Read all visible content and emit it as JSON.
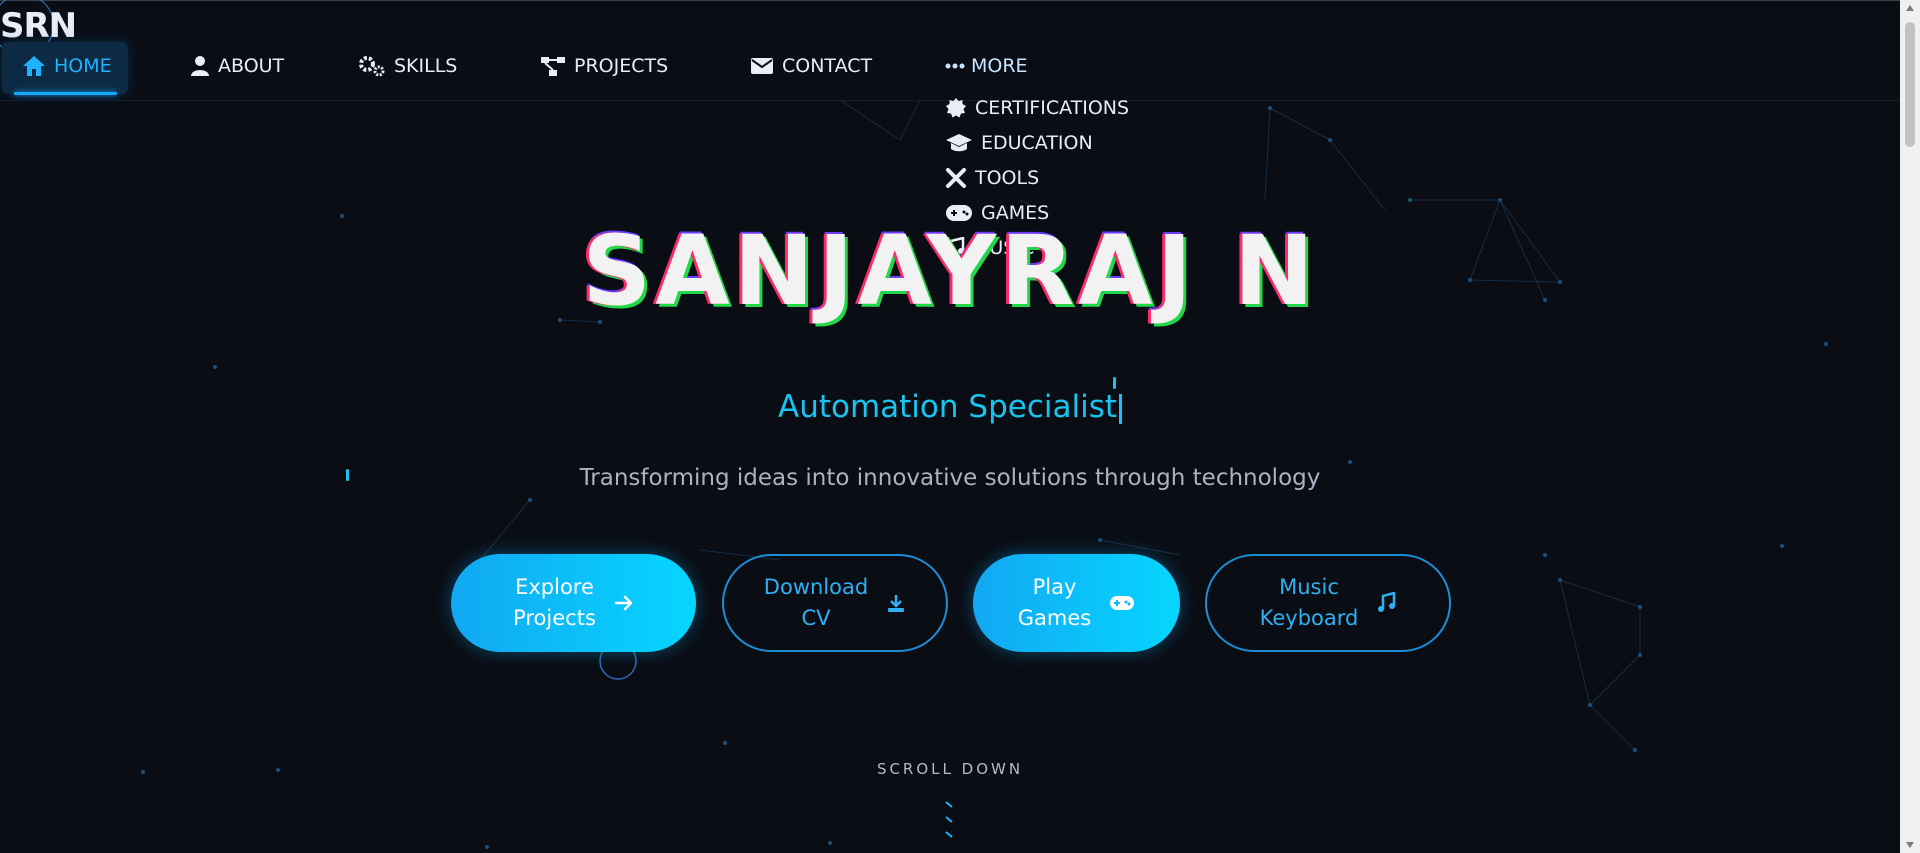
{
  "logo": {
    "text": "SRN"
  },
  "nav": {
    "items": [
      {
        "label": "HOME",
        "icon": "home-icon",
        "active": true
      },
      {
        "label": "ABOUT",
        "icon": "user-icon",
        "active": false
      },
      {
        "label": "SKILLS",
        "icon": "gears-icon",
        "active": false
      },
      {
        "label": "PROJECTS",
        "icon": "project-diagram-icon",
        "active": false
      },
      {
        "label": "CONTACT",
        "icon": "envelope-icon",
        "active": false
      }
    ],
    "more": {
      "label": "MORE",
      "icon": "ellipsis-icon",
      "items": [
        {
          "label": "CERTIFICATIONS",
          "icon": "certificate-icon"
        },
        {
          "label": "EDUCATION",
          "icon": "graduation-cap-icon"
        },
        {
          "label": "TOOLS",
          "icon": "tools-icon"
        },
        {
          "label": "GAMES",
          "icon": "gamepad-icon"
        },
        {
          "label": "MUSIC",
          "icon": "music-icon"
        }
      ]
    }
  },
  "hero": {
    "title": "SANJAYRAJ N",
    "subtitle": "Automation Specialist",
    "tagline": "Transforming ideas into innovative solutions through technology"
  },
  "buttons": {
    "explore": {
      "line1": "Explore",
      "line2": "Projects",
      "icon": "arrow-right-icon"
    },
    "download": {
      "line1": "Download",
      "line2": "CV",
      "icon": "download-icon"
    },
    "games": {
      "line1": "Play",
      "line2": "Games",
      "icon": "gamepad-icon"
    },
    "keyboard": {
      "line1": "Music",
      "line2": "Keyboard",
      "icon": "music-note-icon"
    }
  },
  "scroll": {
    "label": "SCROLL DOWN"
  },
  "colors": {
    "accent": "#1fb2ff",
    "background": "#0a0d14",
    "title_glitch_red": "#ff2a6a",
    "title_glitch_green": "#22d84a"
  }
}
